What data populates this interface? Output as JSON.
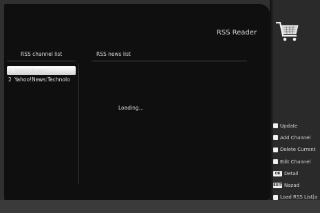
{
  "header": {
    "title": "RSS Reader",
    "cart_icon": "shopping-cart-icon"
  },
  "channels": {
    "heading": "RSS channel list",
    "items": [
      {
        "num": "1",
        "label": "Yahoo!News:..."
      },
      {
        "num": "2",
        "label": "Yahoo!News:Technolo"
      }
    ]
  },
  "news": {
    "heading": "RSS news list",
    "status": "Loading..."
  },
  "legend": {
    "items": [
      {
        "icon": "white-square-icon",
        "label": "Update"
      },
      {
        "icon": "white-square-icon",
        "label": "Add Channel"
      },
      {
        "icon": "white-square-icon",
        "label": "Delete Current"
      },
      {
        "icon": "white-square-icon",
        "label": "Edit Channel"
      },
      {
        "icon": "ok-key-icon",
        "key": "OK",
        "label": "Detail"
      },
      {
        "icon": "exit-key-icon",
        "key": "EXIT",
        "label": "Nazad"
      },
      {
        "icon": "white-square-icon",
        "label": "Load RSS List[a"
      }
    ]
  }
}
